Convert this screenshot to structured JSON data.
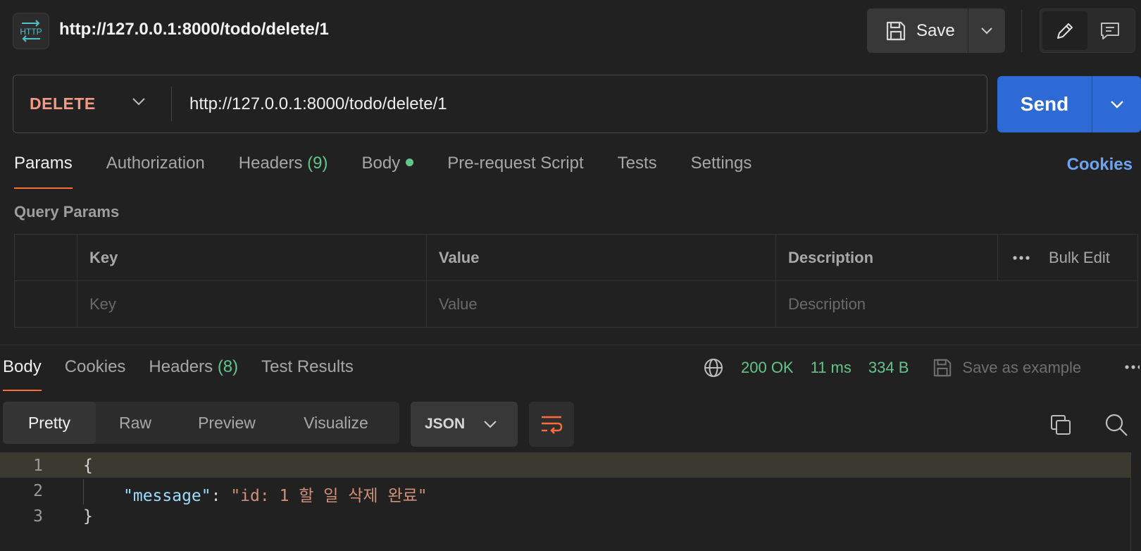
{
  "colors": {
    "background": "#212121",
    "accent_orange": "#ff6c37",
    "send_blue": "#2d6ad6",
    "method_delete": "#f39a86",
    "status_green": "#63c58a",
    "link_blue": "#6ea4ef"
  },
  "header": {
    "badge_icon": "http-icon",
    "tab_title": "http://127.0.0.1:8000/todo/delete/1",
    "save_label": "Save",
    "save_icon": "floppy-disk-icon",
    "edit_icon": "pencil-icon",
    "comment_icon": "comment-icon"
  },
  "request": {
    "method": "DELETE",
    "url": "http://127.0.0.1:8000/todo/delete/1",
    "send_label": "Send"
  },
  "request_tabs": [
    {
      "label": "Params",
      "active": true
    },
    {
      "label": "Authorization"
    },
    {
      "label": "Headers",
      "count": "(9)"
    },
    {
      "label": "Body",
      "dot": true
    },
    {
      "label": "Pre-request Script"
    },
    {
      "label": "Tests"
    },
    {
      "label": "Settings"
    }
  ],
  "cookies_link": "Cookies",
  "query_params": {
    "title": "Query Params",
    "headers": {
      "key": "Key",
      "value": "Value",
      "description": "Description"
    },
    "bulk_edit": "Bulk Edit",
    "placeholders": {
      "key": "Key",
      "value": "Value",
      "description": "Description"
    }
  },
  "response_tabs": [
    {
      "label": "Body",
      "active": true
    },
    {
      "label": "Cookies"
    },
    {
      "label": "Headers",
      "count": "(8)"
    },
    {
      "label": "Test Results"
    }
  ],
  "response_meta": {
    "status": "200 OK",
    "time": "11 ms",
    "size": "334 B",
    "save_example": "Save as example"
  },
  "view_modes": [
    "Pretty",
    "Raw",
    "Preview",
    "Visualize"
  ],
  "active_view": "Pretty",
  "format": "JSON",
  "code": {
    "line_numbers": [
      "1",
      "2",
      "3"
    ],
    "open_brace": "{",
    "key": "\"message\"",
    "colon": ": ",
    "value": "\"id: 1 할 일 삭제 완료\"",
    "close_brace": "}"
  }
}
